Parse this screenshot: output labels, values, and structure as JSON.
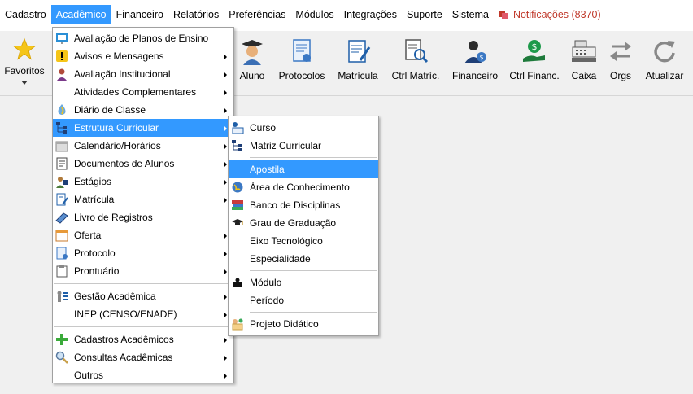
{
  "menubar": {
    "items": [
      {
        "label": "Cadastro"
      },
      {
        "label": "Acadêmico"
      },
      {
        "label": "Financeiro"
      },
      {
        "label": "Relatórios"
      },
      {
        "label": "Preferências"
      },
      {
        "label": "Módulos"
      },
      {
        "label": "Integrações"
      },
      {
        "label": "Suporte"
      },
      {
        "label": "Sistema"
      }
    ],
    "notifications": "Notificações (8370)"
  },
  "toolbar": {
    "favoritos": "Favoritos",
    "aluno": "Aluno",
    "protocolos": "Protocolos",
    "matricula": "Matrícula",
    "ctrl_matric": "Ctrl Matríc.",
    "financeiro": "Financeiro",
    "ctrl_financ": "Ctrl Financ.",
    "caixa": "Caixa",
    "orgs": "Orgs",
    "atualizar": "Atualizar"
  },
  "academico_menu": {
    "items": [
      {
        "label": "Avaliação de Planos de Ensino"
      },
      {
        "label": "Avisos e Mensagens"
      },
      {
        "label": "Avaliação Institucional"
      },
      {
        "label": "Atividades Complementares"
      },
      {
        "label": "Diário de Classe"
      },
      {
        "label": "Estrutura Curricular"
      },
      {
        "label": "Calendário/Horários"
      },
      {
        "label": "Documentos de Alunos"
      },
      {
        "label": "Estágios"
      },
      {
        "label": "Matrícula"
      },
      {
        "label": "Livro de Registros"
      },
      {
        "label": "Oferta"
      },
      {
        "label": "Protocolo"
      },
      {
        "label": "Prontuário"
      },
      {
        "label": "Gestão Acadêmica"
      },
      {
        "label": "INEP (CENSO/ENADE)"
      },
      {
        "label": "Cadastros Acadêmicos"
      },
      {
        "label": "Consultas Acadêmicas"
      },
      {
        "label": "Outros"
      }
    ]
  },
  "estrutura_submenu": {
    "items": [
      {
        "label": "Curso"
      },
      {
        "label": "Matriz Curricular"
      },
      {
        "label": "Apostila"
      },
      {
        "label": "Área de Conhecimento"
      },
      {
        "label": "Banco de Disciplinas"
      },
      {
        "label": "Grau de Graduação"
      },
      {
        "label": "Eixo Tecnológico"
      },
      {
        "label": "Especialidade"
      },
      {
        "label": "Módulo"
      },
      {
        "label": "Período"
      },
      {
        "label": "Projeto Didático"
      }
    ]
  }
}
